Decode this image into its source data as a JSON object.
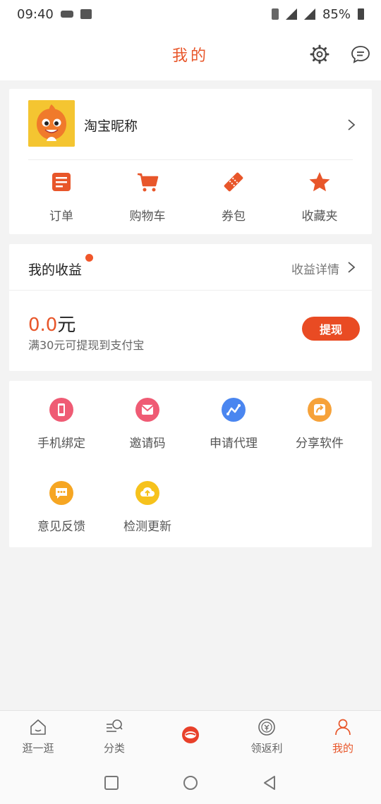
{
  "status_bar": {
    "time": "09:40",
    "battery": "85%"
  },
  "header": {
    "title": "我的"
  },
  "profile": {
    "nickname": "淘宝昵称"
  },
  "shortcuts": [
    {
      "label": "订单",
      "icon": "order-icon"
    },
    {
      "label": "购物车",
      "icon": "cart-icon"
    },
    {
      "label": "券包",
      "icon": "coupon-icon"
    },
    {
      "label": "收藏夹",
      "icon": "star-icon"
    }
  ],
  "earnings": {
    "title": "我的收益",
    "detail_label": "收益详情",
    "amount": "0.0",
    "unit": "元",
    "note": "满30元可提现到支付宝",
    "withdraw_label": "提现"
  },
  "tools": [
    {
      "label": "手机绑定",
      "icon": "phone-icon",
      "color": "#ef5b74"
    },
    {
      "label": "邀请码",
      "icon": "invite-icon",
      "color": "#ef5b74"
    },
    {
      "label": "申请代理",
      "icon": "agent-icon",
      "color": "#4a86f0"
    },
    {
      "label": "分享软件",
      "icon": "share-icon",
      "color": "#f6a23a"
    },
    {
      "label": "意见反馈",
      "icon": "feedback-icon",
      "color": "#f6a623"
    },
    {
      "label": "检测更新",
      "icon": "update-icon",
      "color": "#f6c21c"
    }
  ],
  "tabbar": [
    {
      "label": "逛一逛",
      "icon": "home-icon",
      "active": false
    },
    {
      "label": "分类",
      "icon": "category-icon",
      "active": false
    },
    {
      "label": "",
      "icon": "center-logo-icon",
      "active": false
    },
    {
      "label": "领返利",
      "icon": "rebate-icon",
      "active": false
    },
    {
      "label": "我的",
      "icon": "profile-icon",
      "active": true
    }
  ],
  "colors": {
    "accent": "#e8562a",
    "button": "#e94b23",
    "background": "#f3f3f3"
  }
}
